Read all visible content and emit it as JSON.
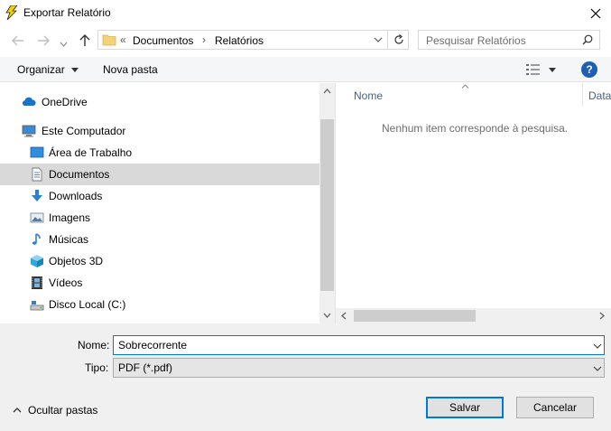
{
  "window": {
    "title": "Exportar Relatório",
    "close_label": "✕"
  },
  "address": {
    "overflow": "«",
    "path": [
      "Documentos",
      "Relatórios"
    ],
    "separator": "›"
  },
  "search": {
    "placeholder": "Pesquisar Relatórios"
  },
  "toolbar": {
    "organize_label": "Organizar",
    "new_folder_label": "Nova pasta"
  },
  "nav": {
    "items": [
      {
        "label": "OneDrive",
        "icon": "cloud-icon"
      },
      {
        "label": "Este Computador",
        "icon": "computer-icon"
      },
      {
        "label": "Área de Trabalho",
        "icon": "desktop-icon"
      },
      {
        "label": "Documentos",
        "icon": "document-icon",
        "selected": true
      },
      {
        "label": "Downloads",
        "icon": "download-arrow-icon"
      },
      {
        "label": "Imagens",
        "icon": "pictures-icon"
      },
      {
        "label": "Músicas",
        "icon": "music-note-icon"
      },
      {
        "label": "Objetos 3D",
        "icon": "cube-icon"
      },
      {
        "label": "Vídeos",
        "icon": "film-icon"
      },
      {
        "label": "Disco Local (C:)",
        "icon": "drive-icon"
      }
    ]
  },
  "files": {
    "columns": [
      "Nome",
      "Data"
    ],
    "empty_message": "Nenhum item corresponde à pesquisa."
  },
  "form": {
    "name_label": "Nome:",
    "name_value": "Sobrecorrente",
    "type_label": "Tipo:",
    "type_value": "PDF (*.pdf)"
  },
  "footer": {
    "hide_folders_label": "Ocultar pastas",
    "save_label": "Salvar",
    "cancel_label": "Cancelar"
  },
  "colors": {
    "accent": "#0078d7",
    "selected_bg": "#d9d9d9",
    "help_blue": "#1e5fb4",
    "folder_yellow": "#f3d27a"
  }
}
